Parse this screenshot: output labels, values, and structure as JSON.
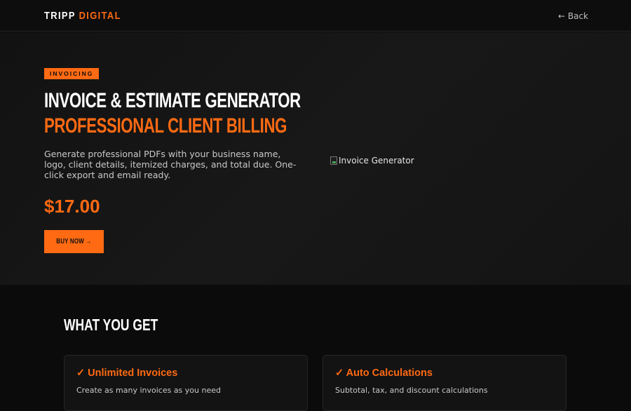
{
  "header": {
    "logo_main": "TRIPP",
    "logo_accent": "DIGITAL",
    "back_label": "← Back"
  },
  "hero": {
    "badge": "INVOICING",
    "title_line1": "INVOICE & ESTIMATE GENERATOR",
    "title_line2": "PROFESSIONAL CLIENT BILLING",
    "description": "Generate professional PDFs with your business name, logo, client details, itemized charges, and total due. One-click export and email ready.",
    "price": "$17.00",
    "buy_label": "BUY NOW →",
    "image_alt": "Invoice Generator"
  },
  "features": {
    "title": "WHAT YOU GET",
    "items": [
      {
        "title": "✓ Unlimited Invoices",
        "description": "Create as many invoices as you need"
      },
      {
        "title": "✓ Auto Calculations",
        "description": "Subtotal, tax, and discount calculations"
      }
    ]
  },
  "colors": {
    "accent": "#ff6a13",
    "background": "#0b0b0b",
    "hero_background": "#161616"
  }
}
